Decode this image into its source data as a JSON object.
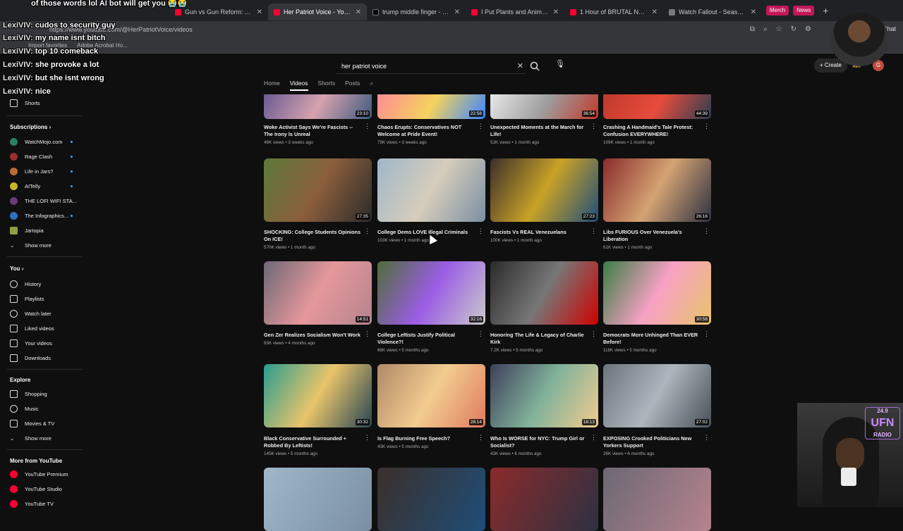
{
  "browser": {
    "tabs": [
      {
        "title": "Gun vs Gun Reform: Are",
        "favicon": "youtube"
      },
      {
        "title": "Her Patriot Voice - YouTube",
        "favicon": "youtube",
        "active": true
      },
      {
        "title": "trump middle finger - Search",
        "favicon": "x"
      },
      {
        "title": "I Put Plants and Animals in a",
        "favicon": "youtube"
      },
      {
        "title": "1 Hour of BRUTAL NHL Fight",
        "favicon": "youtube"
      },
      {
        "title": "Watch Fallout - Season 2 | Pr",
        "favicon": "generic"
      }
    ],
    "pills": [
      "Merch",
      "News"
    ],
    "url": "https://www.youtube.com/@HerPatriotVoice/videos",
    "bookmarks": [
      "Import favorites",
      "Adobe Acrobat Ho..."
    ],
    "chat_label": "Chat"
  },
  "youtube": {
    "search_value": "her patriot voice",
    "create_label": "Create",
    "avatar_letter": "G",
    "channel_tabs": [
      "Home",
      "Videos",
      "Shorts",
      "Posts"
    ],
    "active_tab": "Videos"
  },
  "sidebar": {
    "shorts": "Shorts",
    "subscriptions_heading": "Subscriptions",
    "subscriptions": [
      "WatchMojo.com",
      "Rage Clash",
      "Life in Jars?",
      "AITelly",
      "THE LOFI WIFI STA...",
      "The Infographics...",
      "Jartopia"
    ],
    "show_more": "Show more",
    "you_heading": "You",
    "you_items": [
      "History",
      "Playlists",
      "Watch later",
      "Liked videos",
      "Your videos",
      "Downloads"
    ],
    "explore_heading": "Explore",
    "explore_items": [
      "Shopping",
      "Music",
      "Movies & TV"
    ],
    "show_more_2": "Show more",
    "more_heading": "More from YouTube",
    "more_items": [
      "YouTube Premium",
      "YouTube Studio",
      "YouTube TV"
    ]
  },
  "videos": [
    {
      "title": "Woke Activist Says We're Fascists -- The Irony Is Unreal",
      "meta": "46K views • 3 weeks ago",
      "duration": "23:10"
    },
    {
      "title": "Chaos Erupts: Conservatives NOT Welcome at Pride Event!",
      "meta": "79K views • 3 weeks ago",
      "duration": "22:58"
    },
    {
      "title": "Unexpected Moments at the March for Life!",
      "meta": "53K views • 1 month ago",
      "duration": "36:54"
    },
    {
      "title": "Crashing A Handmaid's Tale Protest: Confusion EVERYWHERE!",
      "meta": "109K views • 1 month ago",
      "duration": "44:39"
    },
    {
      "title": "SHOCKING: College Students Opinions On ICE!",
      "meta": "570K views • 1 month ago",
      "duration": "27:35"
    },
    {
      "title": "College Dems LOVE Illegal Criminals",
      "meta": "103K views • 1 month ago",
      "duration": ""
    },
    {
      "title": "Fascists Vs REAL Venezuelans",
      "meta": "100K views • 1 month ago",
      "duration": "27:23"
    },
    {
      "title": "Libs FURIOUS Over Venezuela's Liberation",
      "meta": "61K views • 1 month ago",
      "duration": "26:16"
    },
    {
      "title": "Gen Zer Realizes Socialism Won't Work",
      "meta": "93K views • 4 months ago",
      "duration": "14:51"
    },
    {
      "title": "College Leftists Justify Political Violence?!",
      "meta": "68K views • 5 months ago",
      "duration": "32:16"
    },
    {
      "title": "Honoring The Life & Legacy of Charlie Kirk",
      "meta": "7.2K views • 5 months ago",
      "duration": ""
    },
    {
      "title": "Democrats More Unhinged Than EVER Before!",
      "meta": "118K views • 5 months ago",
      "duration": "30:58"
    },
    {
      "title": "Black Conservative Surrounded + Robbed By Leftists!",
      "meta": "145K views • 5 months ago",
      "duration": "30:32"
    },
    {
      "title": "Is Flag Burning Free Speech?",
      "meta": "43K views • 5 months ago",
      "duration": "28:14"
    },
    {
      "title": "Who Is WORSE for NYC: Trump Girl or Socialist?",
      "meta": "43K views • 6 months ago",
      "duration": "18:13"
    },
    {
      "title": "EXPOSING Crooked Politicians New Yorkers Support",
      "meta": "26K views • 6 months ago",
      "duration": "27:02"
    }
  ],
  "chat_overlay": [
    {
      "user": "LexiVIV:",
      "msg": "cudos to security guy"
    },
    {
      "user": "LexiVIV:",
      "msg": "my name isnt bitch"
    },
    {
      "user": "LexiVIV:",
      "msg": "top 10 comeback"
    },
    {
      "user": "LexiVIV:",
      "msg": "she provoke a lot"
    },
    {
      "user": "LexiVIV:",
      "msg": "but she isnt wrong"
    },
    {
      "user": "LexiVIV:",
      "msg": "nice"
    }
  ],
  "chat_top": "of those words lol AI bot will get you 😭😭",
  "stream_overlay": {
    "logo_text": "UFN",
    "logo_sub": "RADIO",
    "frequency": "24.9"
  }
}
